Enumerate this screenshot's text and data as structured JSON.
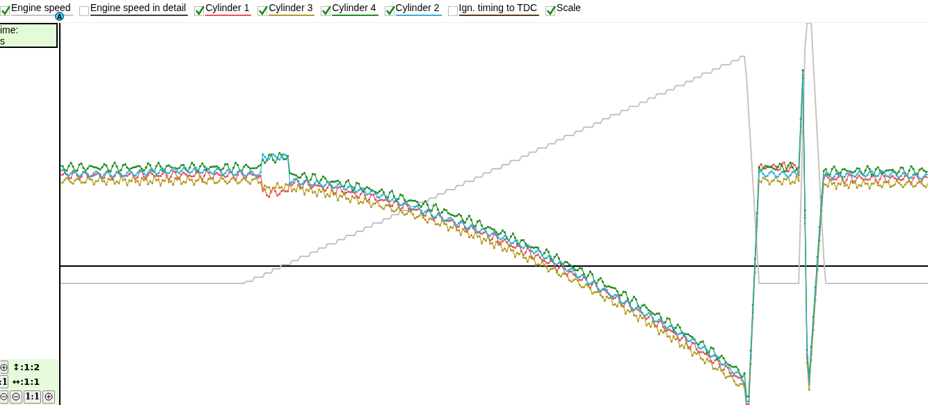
{
  "legend": [
    {
      "label": "Engine speed",
      "kind": "rpm",
      "checked": true,
      "color": "#c4c4c4"
    },
    {
      "label": "Engine speed in detail",
      "kind": "detail",
      "checked": false,
      "color": "#404040"
    },
    {
      "label": "Cylinder 1",
      "kind": "cylinder",
      "checked": true,
      "color": "#e8525a"
    },
    {
      "label": "Cylinder 3",
      "kind": "cylinder",
      "checked": true,
      "color": "#b39a22"
    },
    {
      "label": "Cylinder 4",
      "kind": "cylinder",
      "checked": true,
      "color": "#1f8c1f"
    },
    {
      "label": "Cylinder 2",
      "kind": "cylinder",
      "checked": true,
      "color": "#2fb0d4"
    },
    {
      "label": "Ign. timing to TDC",
      "kind": "timing",
      "checked": false,
      "color": "#5a3b18"
    },
    {
      "label": "Scale",
      "kind": "scale",
      "checked": true
    }
  ],
  "cursor_marker": "A",
  "time_box": {
    "label": "ime:",
    "value": "s"
  },
  "zoom_controls": {
    "vertical_reading": "↕:1:2",
    "horizontal_button": ":1",
    "horizontal_reading": "↔:1:1",
    "reset_button": "1:1"
  }
}
